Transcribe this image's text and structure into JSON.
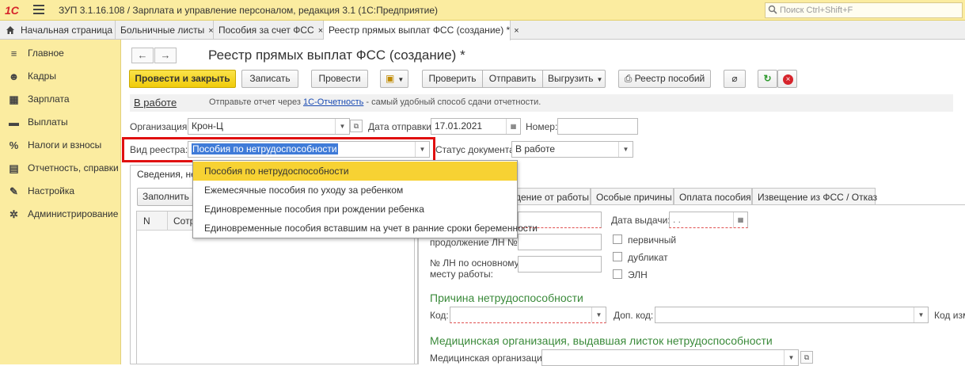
{
  "app": {
    "logo": "1С",
    "title": "ЗУП 3.1.16.108 / Зарплата и управление персоналом, редакция 3.1  (1С:Предприятие)",
    "search_placeholder": "Поиск Ctrl+Shift+F"
  },
  "tabs": [
    {
      "label": "Начальная страница",
      "icon": "home-icon",
      "closable": false
    },
    {
      "label": "Больничные листы",
      "closable": true
    },
    {
      "label": "Пособия за счет ФСС",
      "closable": true
    },
    {
      "label": "Реестр прямых выплат ФСС (создание) *",
      "closable": true,
      "active": true
    }
  ],
  "close_glyph": "×",
  "sidebar": {
    "items": [
      {
        "label": "Главное",
        "icon": "menu-icon"
      },
      {
        "label": "Кадры",
        "icon": "people-icon"
      },
      {
        "label": "Зарплата",
        "icon": "calculator-icon"
      },
      {
        "label": "Выплаты",
        "icon": "wallet-icon"
      },
      {
        "label": "Налоги и взносы",
        "icon": "percent-icon"
      },
      {
        "label": "Отчетность, справки",
        "icon": "report-icon"
      },
      {
        "label": "Настройка",
        "icon": "wrench-icon"
      },
      {
        "label": "Администрирование",
        "icon": "gear-icon"
      }
    ]
  },
  "form": {
    "title": "Реестр прямых выплат ФСС (создание) *",
    "toolbar": {
      "post_and_close": "Провести и закрыть",
      "save": "Записать",
      "post": "Провести",
      "check": "Проверить",
      "send": "Отправить",
      "upload": "Выгрузить",
      "benefits_registry": "Реестр пособий"
    },
    "info": {
      "status": "В работе",
      "text_before": "Отправьте отчет через ",
      "link": "1С-Отчетность",
      "text_after": " - самый удобный способ сдачи отчетности."
    },
    "org_label": "Организация:",
    "org_value": "Крон-Ц",
    "send_date_label": "Дата отправки:",
    "send_date_value": "17.01.2021",
    "number_label": "Номер:",
    "number_value": "",
    "registry_type_label": "Вид реестра:",
    "registry_type_value": "Пособия по нетрудоспособности",
    "doc_status_label": "Статус документа:",
    "doc_status_value": "В работе",
    "dropdown_options": [
      "Пособия по нетрудоспособности",
      "Ежемесячные пособия по уходу за ребенком",
      "Единовременные пособия при рождении ребенка",
      "Единовременные пособия вставшим на учет в ранние сроки беременности"
    ],
    "left_tab": "Сведения, не",
    "fill_button": "Заполнить",
    "grid_columns": [
      "N",
      "Сотр"
    ],
    "right_tabs": [
      "дение от работы",
      "Особые причины",
      "Оплата пособия",
      "Извещение из ФСС / Отказ"
    ],
    "issue_date_label": "Дата выдачи:",
    "issue_date_value": " .  .",
    "continuation_label": "продолжение ЛН №:",
    "main_job_label_1": "№ ЛН по основному",
    "main_job_label_2": "месту работы:",
    "checkboxes": [
      "первичный",
      "дубликат",
      "ЭЛН"
    ],
    "reason_title": "Причина нетрудоспособности",
    "code_label": "Код:",
    "extra_code_label": "Доп. код:",
    "change_code_label": "Код изм",
    "med_org_title": "Медицинская организация, выдавшая листок нетрудоспособности",
    "med_org_label": "Медицинская организация:"
  }
}
